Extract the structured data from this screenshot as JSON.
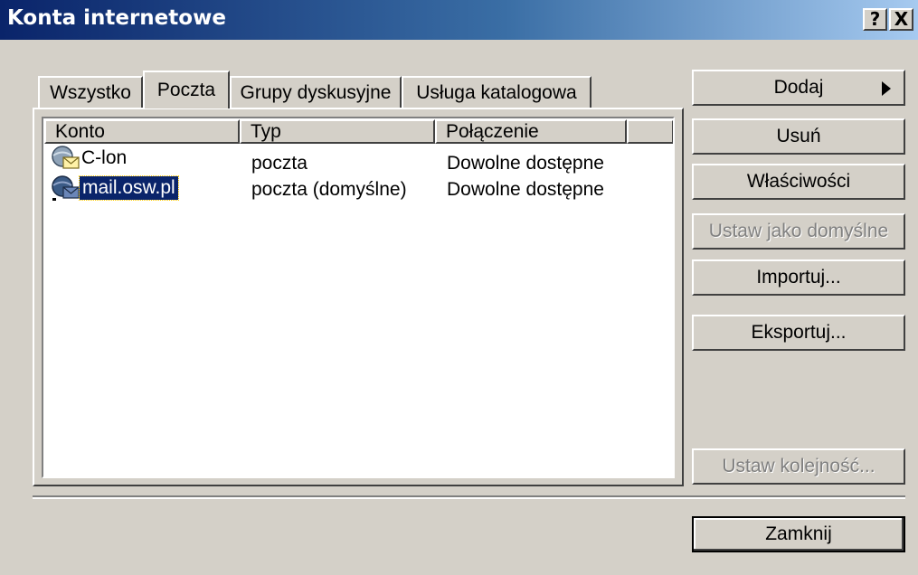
{
  "window": {
    "title": "Konta internetowe",
    "help_button": "?",
    "close_button": "X"
  },
  "tabs": [
    {
      "label": "Wszystko",
      "active": false
    },
    {
      "label": "Poczta",
      "active": true
    },
    {
      "label": "Grupy dyskusyjne",
      "active": false
    },
    {
      "label": "Usługa katalogowa",
      "active": false
    }
  ],
  "list": {
    "columns": [
      "Konto",
      "Typ",
      "Połączenie"
    ],
    "rows": [
      {
        "account": "C-lon",
        "type": "poczta",
        "connection": "Dowolne dostępne",
        "icon": "mail-account-icon",
        "selected": false
      },
      {
        "account": "mail.osw.pl",
        "type": "poczta (domyślne)",
        "connection": "Dowolne dostępne",
        "icon": "mail-account-default-icon",
        "selected": true
      }
    ]
  },
  "buttons": {
    "add": "Dodaj",
    "remove": "Usuń",
    "properties": "Właściwości",
    "set_default": "Ustaw jako domyślne",
    "import": "Importuj...",
    "export": "Eksportuj...",
    "set_order": "Ustaw kolejność...",
    "close": "Zamknij"
  },
  "colors": {
    "face": "#d4d0c8",
    "titlebar": "#0a246a",
    "selection": "#0a246a"
  }
}
